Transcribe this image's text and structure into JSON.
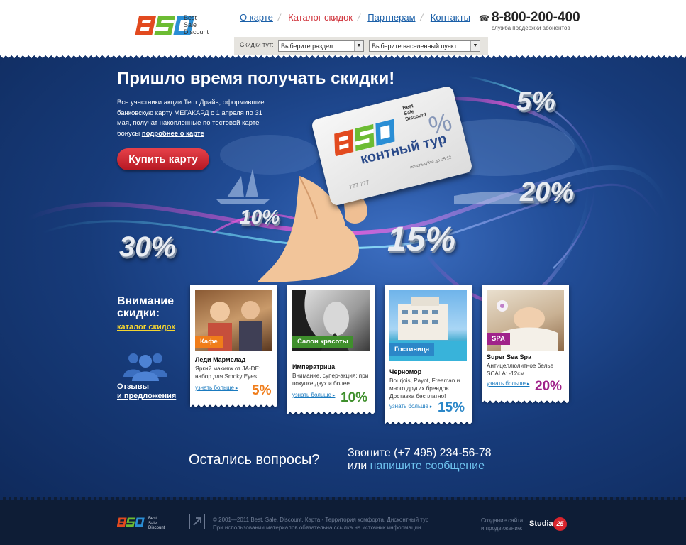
{
  "header": {
    "logo": {
      "tagline": [
        "Best",
        "Sale",
        "Discount"
      ]
    },
    "nav": [
      {
        "label": "О карте",
        "active": false
      },
      {
        "label": "Каталог скидок",
        "active": true
      },
      {
        "label": "Партнерам",
        "active": false
      },
      {
        "label": "Контакты",
        "active": false
      }
    ],
    "phone": "8-800-200-400",
    "phone_sub": "служба поддержки абонентов"
  },
  "filter": {
    "label": "Скидки тут:",
    "section_select": "Выберите раздел",
    "city_select": "Выберите населенный пункт"
  },
  "hero": {
    "title": "Пришло время получать скидки!",
    "text": "Все участники акции Тест Драйв, оформившие банковскую карту МЕГАКАРД с 1 апреля по 31 мая, получат накопленные по тестовой карте бонусы",
    "more_link": "подробнее о карте",
    "buy_button": "Купить карту",
    "percents": [
      "5%",
      "20%",
      "10%",
      "30%",
      "15%"
    ],
    "card": {
      "brand": [
        "Best",
        "Sale",
        "Discount"
      ],
      "tour": "контный тур",
      "percent": "%",
      "number": "777 777",
      "site": "используйте до 05/12"
    }
  },
  "side": {
    "attention": [
      "Внимание",
      "скидки:"
    ],
    "catalog_link": "каталог скидок",
    "reviews_link": [
      "Отзывы",
      "и предложения"
    ]
  },
  "offers": [
    {
      "tag": "Кафе",
      "name": "Леди Мармелад",
      "desc": "Яркий макияж от JA-DE: набор для Smoky Eyes",
      "more": "узнать больше",
      "discount": "5%",
      "color": "#f07d1a"
    },
    {
      "tag": "Салон красоты",
      "name": "Императрица",
      "desc": "Внимание, супер-акция: при покупке двух и более",
      "more": "узнать больше",
      "discount": "10%",
      "color": "#3f8f2c"
    },
    {
      "tag": "Гостиница",
      "name": "Черномор",
      "desc": "Bourjois, Payot, Freeman и много других брендов Доставка бесплатно!",
      "more": "узнать больше",
      "discount": "15%",
      "color": "#2b87c8"
    },
    {
      "tag": "SPA",
      "name": "Super Sea Spa",
      "desc": "Антицеллюлитное белье SCALA: -12см",
      "more": "узнать больше",
      "discount": "20%",
      "color": "#a0228a"
    }
  ],
  "contact": {
    "questions": "Остались вопросы?",
    "call": "Звоните (+7 495) 234-56-78",
    "or": "или",
    "write_link": "напишите сообщение"
  },
  "footer": {
    "tagline": [
      "Best",
      "Sale",
      "Discount"
    ],
    "copyright": [
      "© 2001—2011 Best. Sale. Discount. Карта - Территория комфорта. Дисконтный тур",
      "При использовании материалов обязательна ссылка на источник информации"
    ],
    "made_by": [
      "Создание сайта",
      "и продвижение:"
    ],
    "studio": "Studia",
    "studio_num": "25"
  }
}
